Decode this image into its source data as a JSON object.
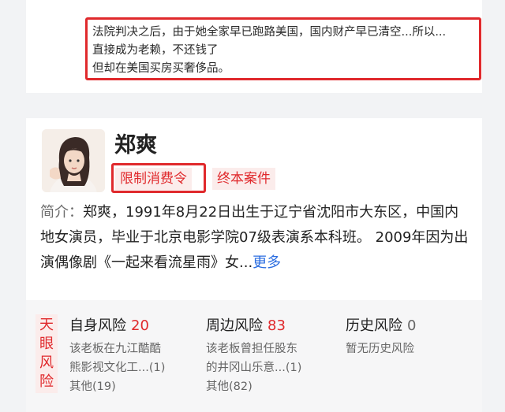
{
  "note": {
    "lines": [
      "法院判决之后，由于她全家早已跑路美国，国内财产早已清空...所以...",
      "直接成为老赖，不还钱了",
      "但却在美国买房买奢侈品。"
    ]
  },
  "profile": {
    "name": "郑爽",
    "tags": [
      "限制消费令",
      "终本案件"
    ],
    "intro_label": "简介：",
    "intro_text": "郑爽，1991年8月22日出生于辽宁省沈阳市大东区，中国内地女演员，毕业于北京电影学院07级表演系本科班。 2009年因为出演偶像剧《一起来看流星雨》女...",
    "more_label": "更多"
  },
  "risk": {
    "brand": "天眼风险",
    "self": {
      "title": "自身风险",
      "count": "20",
      "lines": [
        "该老板在九江酷酷",
        "熊影视文化工...(1)",
        "其他(19)"
      ]
    },
    "around": {
      "title": "周边风险",
      "count": "83",
      "lines": [
        "该老板曾担任股东",
        "的井冈山乐意...(1)",
        "其他(82)"
      ]
    },
    "history": {
      "title": "历史风险",
      "count": "0",
      "lines": [
        "暂无历史风险"
      ]
    }
  },
  "colors": {
    "accent_red": "#e0292c",
    "link_blue": "#2b6de0",
    "tag_bg": "#fbeceb"
  }
}
